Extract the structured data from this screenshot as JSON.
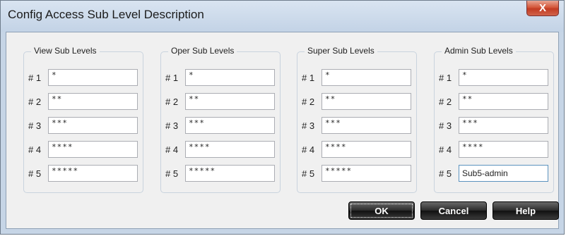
{
  "window": {
    "title": "Config Access Sub Level Description",
    "close_glyph": "X"
  },
  "groups": [
    {
      "title": "View Sub Levels",
      "rows": [
        {
          "label": "# 1",
          "value": "*"
        },
        {
          "label": "# 2",
          "value": "**"
        },
        {
          "label": "# 3",
          "value": "***"
        },
        {
          "label": "# 4",
          "value": "****"
        },
        {
          "label": "# 5",
          "value": "*****"
        }
      ]
    },
    {
      "title": "Oper Sub Levels",
      "rows": [
        {
          "label": "# 1",
          "value": "*"
        },
        {
          "label": "# 2",
          "value": "**"
        },
        {
          "label": "# 3",
          "value": "***"
        },
        {
          "label": "# 4",
          "value": "****"
        },
        {
          "label": "# 5",
          "value": "*****"
        }
      ]
    },
    {
      "title": "Super Sub Levels",
      "rows": [
        {
          "label": "# 1",
          "value": "*"
        },
        {
          "label": "# 2",
          "value": "**"
        },
        {
          "label": "# 3",
          "value": "***"
        },
        {
          "label": "# 4",
          "value": "****"
        },
        {
          "label": "# 5",
          "value": "*****"
        }
      ]
    },
    {
      "title": "Admin Sub Levels",
      "rows": [
        {
          "label": "# 1",
          "value": "*"
        },
        {
          "label": "# 2",
          "value": "**"
        },
        {
          "label": "# 3",
          "value": "***"
        },
        {
          "label": "# 4",
          "value": "****"
        },
        {
          "label": "# 5",
          "value": "Sub5-admin"
        }
      ]
    }
  ],
  "buttons": {
    "ok": "OK",
    "cancel": "Cancel",
    "help": "Help"
  }
}
